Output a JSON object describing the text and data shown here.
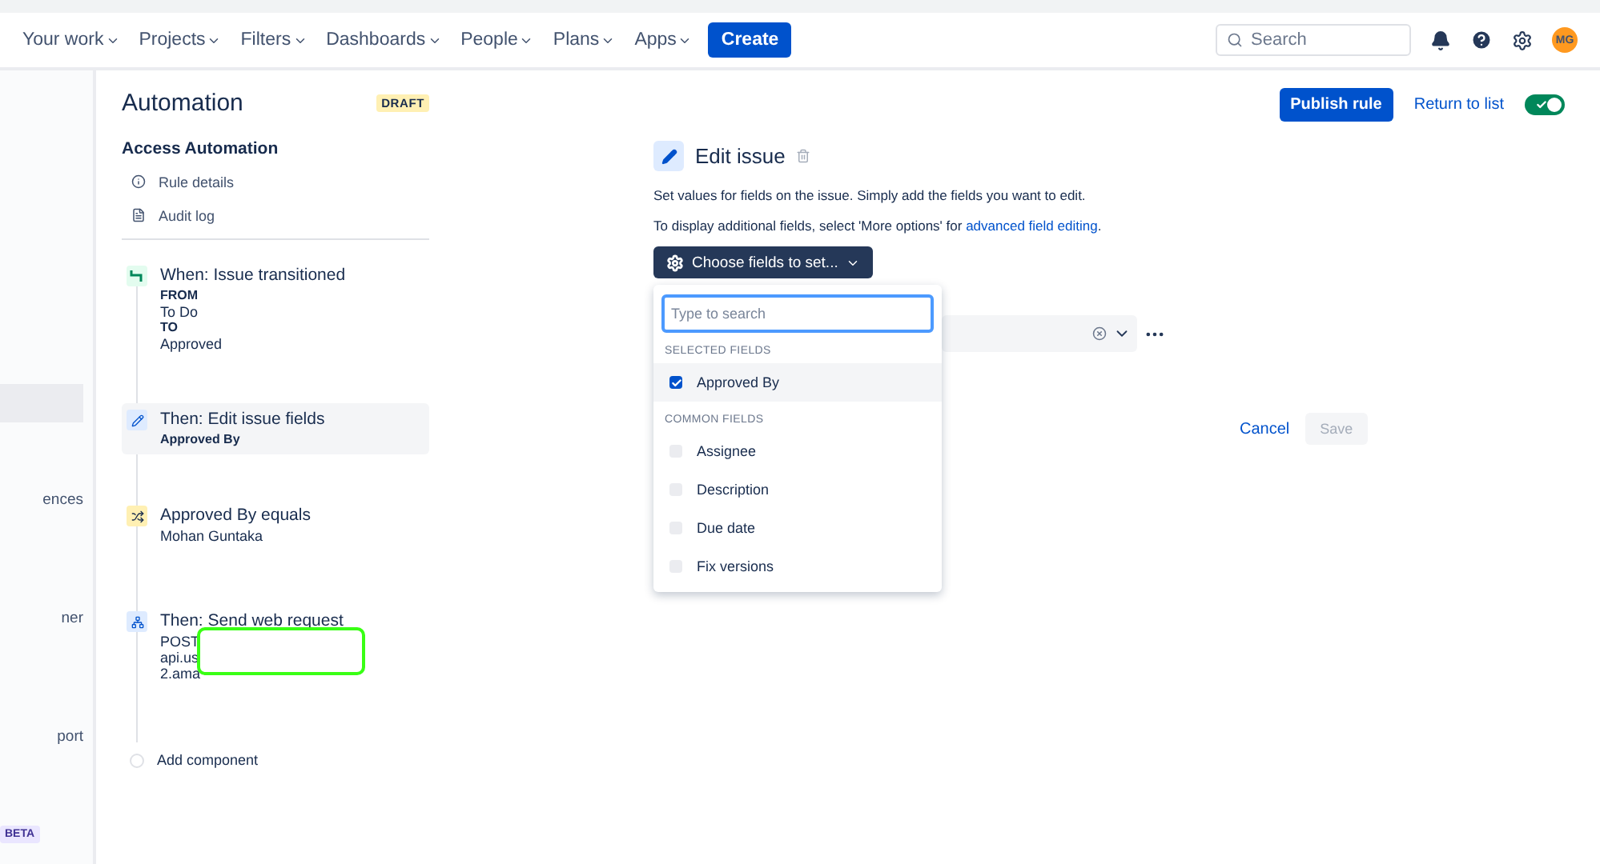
{
  "nav": {
    "items": [
      "Your work",
      "Projects",
      "Filters",
      "Dashboards",
      "People",
      "Plans",
      "Apps"
    ],
    "create": "Create",
    "search": {
      "placeholder": "Search"
    },
    "avatar": "MG"
  },
  "sidebar": {
    "items": [
      {
        "selected": true
      },
      {
        "label": "ences",
        "selected": false
      },
      {
        "label": "ner",
        "selected": false
      },
      {
        "label": "port",
        "selected": false
      }
    ],
    "badge": "BETA"
  },
  "rule": {
    "title": "Automation",
    "status": "DRAFT",
    "section": "Access Automation",
    "links": [
      {
        "kind": "info",
        "label": "Rule details"
      },
      {
        "kind": "log",
        "label": "Audit log"
      }
    ],
    "components": [
      {
        "kind": "trigger",
        "title": "When: Issue transitioned",
        "selected": false,
        "lines": [
          {
            "text": "FROM",
            "bold": true
          },
          {
            "text": "To Do",
            "bold": false
          },
          {
            "text": "TO",
            "bold": true
          },
          {
            "text": "Approved",
            "bold": false
          }
        ]
      },
      {
        "kind": "action",
        "title": "Then: Edit issue fields",
        "selected": true,
        "lines": [
          {
            "text": "Approved By",
            "bold": true
          }
        ]
      },
      {
        "kind": "condition",
        "title": "Approved By equals",
        "selected": false,
        "lines": [
          {
            "text": "Mohan Guntaka",
            "bold": false
          }
        ]
      },
      {
        "kind": "webhook",
        "title": "Then: Send web request",
        "selected": false,
        "lines": [
          {
            "text": "POST",
            "bold": false
          },
          {
            "text": "api.us",
            "bold": false
          },
          {
            "text": "2.ama",
            "bold": false
          }
        ]
      }
    ],
    "add": "Add component"
  },
  "header": {
    "publish": "Publish rule",
    "return": "Return to list",
    "enabled": true
  },
  "editor": {
    "title": "Edit issue",
    "description": "Set values for fields on the issue. Simply add the fields you want to edit.",
    "hint_prefix": "To display additional fields, select 'More options' for ",
    "hint_link": "advanced field editing",
    "hint_suffix": ".",
    "choose": "Choose fields to set...",
    "cancel": "Cancel",
    "save": {
      "label": "Save",
      "disabled": true
    }
  },
  "dropdown": {
    "placeholder": "Type to search",
    "groups": [
      {
        "heading": "SELECTED FIELDS",
        "fields": [
          {
            "label": "Approved By",
            "checked": true
          }
        ]
      },
      {
        "heading": "COMMON FIELDS",
        "fields": [
          {
            "label": "Assignee",
            "checked": false
          },
          {
            "label": "Description",
            "checked": false
          },
          {
            "label": "Due date",
            "checked": false
          },
          {
            "label": "Fix versions",
            "checked": false
          }
        ]
      }
    ]
  }
}
